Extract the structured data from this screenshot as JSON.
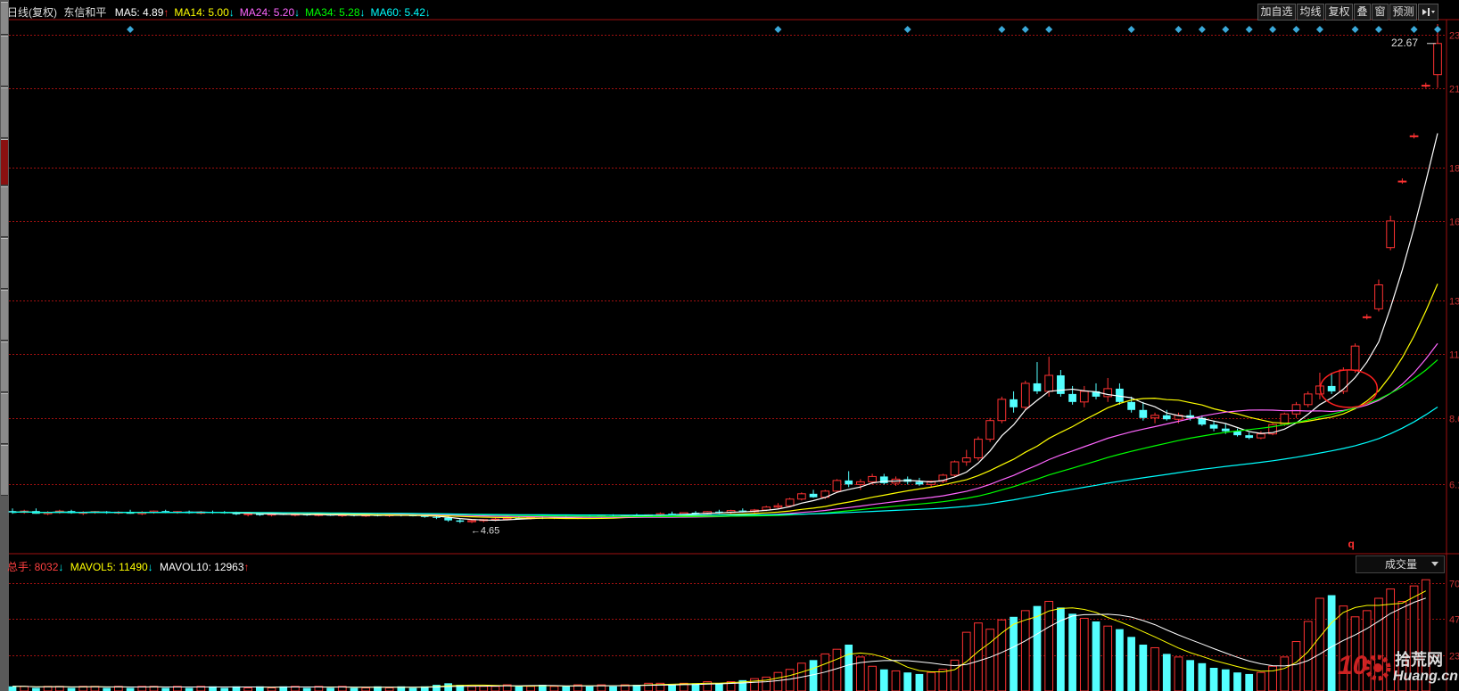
{
  "header": {
    "period": "日线(复权)",
    "stock_name": "东信和平",
    "ma": [
      {
        "label": "MA5: 4.89",
        "arrow": "↑",
        "color": "#ffffff",
        "arrow_color": "#ff3030"
      },
      {
        "label": "MA14: 5.00",
        "arrow": "↓",
        "color": "#ffff00",
        "arrow_color": "#00ffff"
      },
      {
        "label": "MA24: 5.20",
        "arrow": "↓",
        "color": "#ff66ff",
        "arrow_color": "#00ffff"
      },
      {
        "label": "MA34: 5.28",
        "arrow": "↓",
        "color": "#00ff00",
        "arrow_color": "#00ffff"
      },
      {
        "label": "MA60: 5.42",
        "arrow": "↓",
        "color": "#00ffff",
        "arrow_color": "#00ffff"
      }
    ]
  },
  "toolbar": {
    "add_watch": "加自选",
    "avg_line": "均线",
    "rights": "复权",
    "overlay": "叠",
    "window": "窗",
    "forecast": "预测",
    "menu_icon": "dropdown-arrow-icon"
  },
  "volume_panel": {
    "total_label": "总手: 8032",
    "total_arrow": "↓",
    "mavol5": "MAVOL5: 11490",
    "mavol5_arrow": "↓",
    "mavol10": "MAVOL10: 12963",
    "mavol10_arrow": "↑",
    "indicator": "成交量",
    "y_ticks": [
      "70",
      "47",
      "23"
    ]
  },
  "annotations": {
    "high_label": "22.67",
    "low_label": "4.65",
    "q_label": "q"
  },
  "watermark": {
    "line1": "10",
    "line2": "拾荒网",
    "line3": "Huang.cn"
  },
  "colors": {
    "up": "#ff3232",
    "down": "#54ffff",
    "ma5": "#ffffff",
    "ma14": "#ffff00",
    "ma24": "#ff66ff",
    "ma34": "#00ff00",
    "ma60": "#00ffff",
    "grid": "#a01010"
  },
  "chart_data": {
    "type": "candlestick",
    "title": "东信和平 日线(复权)",
    "price_axis_ticks": [
      "23",
      "21",
      "18",
      "16",
      "13",
      "11",
      "8.6",
      "6.1"
    ],
    "ylim": [
      3.7,
      23.5
    ],
    "grid": true,
    "candles_ohlc": [
      [
        5.1,
        5.2,
        5.0,
        5.05
      ],
      [
        5.05,
        5.15,
        5.0,
        5.1
      ],
      [
        5.1,
        5.2,
        5.0,
        5.0
      ],
      [
        5.0,
        5.1,
        4.95,
        5.05
      ],
      [
        5.05,
        5.15,
        5.0,
        5.1
      ],
      [
        5.1,
        5.15,
        5.0,
        5.02
      ],
      [
        5.02,
        5.1,
        4.95,
        5.05
      ],
      [
        5.05,
        5.1,
        5.0,
        5.08
      ],
      [
        5.08,
        5.1,
        5.0,
        5.03
      ],
      [
        5.03,
        5.1,
        4.98,
        5.06
      ],
      [
        5.06,
        5.15,
        5.0,
        5.0
      ],
      [
        5.0,
        5.1,
        4.95,
        5.05
      ],
      [
        5.05,
        5.12,
        5.0,
        5.1
      ],
      [
        5.1,
        5.15,
        5.02,
        5.04
      ],
      [
        5.04,
        5.1,
        5.0,
        5.08
      ],
      [
        5.08,
        5.12,
        5.0,
        5.02
      ],
      [
        5.02,
        5.1,
        4.98,
        5.06
      ],
      [
        5.06,
        5.12,
        5.0,
        5.05
      ],
      [
        5.05,
        5.1,
        5.0,
        5.02
      ],
      [
        5.02,
        5.08,
        4.95,
        4.98
      ],
      [
        4.98,
        5.05,
        4.9,
        5.0
      ],
      [
        5.0,
        5.05,
        4.92,
        4.95
      ],
      [
        4.95,
        5.02,
        4.9,
        5.0
      ],
      [
        5.0,
        5.05,
        4.95,
        4.96
      ],
      [
        4.96,
        5.0,
        4.9,
        4.98
      ],
      [
        4.98,
        5.02,
        4.92,
        4.94
      ],
      [
        4.94,
        5.0,
        4.9,
        4.97
      ],
      [
        4.97,
        5.0,
        4.92,
        4.93
      ],
      [
        4.93,
        5.0,
        4.88,
        4.96
      ],
      [
        4.96,
        5.0,
        4.9,
        4.92
      ],
      [
        4.92,
        4.98,
        4.88,
        4.95
      ],
      [
        4.95,
        5.0,
        4.9,
        4.93
      ],
      [
        4.93,
        4.98,
        4.88,
        4.96
      ],
      [
        4.96,
        5.0,
        4.9,
        4.94
      ],
      [
        4.94,
        4.98,
        4.9,
        4.92
      ],
      [
        4.92,
        4.95,
        4.85,
        4.88
      ],
      [
        4.88,
        4.92,
        4.8,
        4.85
      ],
      [
        4.85,
        4.9,
        4.7,
        4.75
      ],
      [
        4.75,
        4.8,
        4.65,
        4.7
      ],
      [
        4.7,
        4.78,
        4.65,
        4.74
      ],
      [
        4.74,
        4.8,
        4.68,
        4.78
      ],
      [
        4.78,
        4.85,
        4.72,
        4.8
      ],
      [
        4.8,
        4.88,
        4.75,
        4.84
      ],
      [
        4.84,
        4.9,
        4.78,
        4.82
      ],
      [
        4.82,
        4.9,
        4.78,
        4.86
      ],
      [
        4.86,
        4.92,
        4.8,
        4.84
      ],
      [
        4.84,
        4.9,
        4.8,
        4.88
      ],
      [
        4.88,
        4.95,
        4.82,
        4.86
      ],
      [
        4.86,
        4.92,
        4.8,
        4.9
      ],
      [
        4.9,
        4.96,
        4.85,
        4.88
      ],
      [
        4.88,
        4.95,
        4.82,
        4.92
      ],
      [
        4.92,
        4.98,
        4.86,
        4.9
      ],
      [
        4.9,
        4.96,
        4.85,
        4.94
      ],
      [
        4.94,
        5.0,
        4.88,
        4.92
      ],
      [
        4.92,
        4.98,
        4.88,
        4.96
      ],
      [
        4.96,
        5.05,
        4.9,
        5.0
      ],
      [
        5.0,
        5.08,
        4.95,
        4.98
      ],
      [
        4.98,
        5.05,
        4.92,
        5.04
      ],
      [
        5.04,
        5.1,
        4.98,
        5.0
      ],
      [
        5.0,
        5.1,
        4.95,
        5.08
      ],
      [
        5.08,
        5.15,
        5.0,
        5.05
      ],
      [
        5.05,
        5.15,
        5.0,
        5.12
      ],
      [
        5.12,
        5.2,
        5.05,
        5.08
      ],
      [
        5.08,
        5.18,
        5.02,
        5.14
      ],
      [
        5.14,
        5.3,
        5.1,
        5.25
      ],
      [
        5.25,
        5.4,
        5.2,
        5.3
      ],
      [
        5.3,
        5.6,
        5.25,
        5.55
      ],
      [
        5.55,
        5.8,
        5.5,
        5.75
      ],
      [
        5.75,
        5.9,
        5.6,
        5.62
      ],
      [
        5.62,
        5.9,
        5.55,
        5.85
      ],
      [
        5.85,
        6.3,
        5.8,
        6.25
      ],
      [
        6.25,
        6.6,
        6.0,
        6.1
      ],
      [
        6.1,
        6.3,
        5.9,
        6.2
      ],
      [
        6.2,
        6.5,
        6.1,
        6.4
      ],
      [
        6.4,
        6.5,
        6.1,
        6.15
      ],
      [
        6.15,
        6.4,
        6.05,
        6.3
      ],
      [
        6.3,
        6.4,
        6.1,
        6.2
      ],
      [
        6.2,
        6.35,
        6.05,
        6.1
      ],
      [
        6.1,
        6.25,
        6.0,
        6.22
      ],
      [
        6.22,
        6.5,
        6.15,
        6.45
      ],
      [
        6.45,
        7.0,
        6.4,
        6.95
      ],
      [
        6.95,
        7.4,
        6.8,
        7.1
      ],
      [
        7.1,
        7.9,
        7.0,
        7.8
      ],
      [
        7.8,
        8.6,
        7.7,
        8.5
      ],
      [
        8.5,
        9.4,
        8.4,
        9.3
      ],
      [
        9.3,
        9.6,
        8.8,
        9.0
      ],
      [
        9.0,
        10.0,
        8.9,
        9.9
      ],
      [
        9.9,
        10.7,
        9.5,
        9.6
      ],
      [
        9.6,
        10.9,
        9.4,
        10.2
      ],
      [
        10.2,
        10.4,
        9.4,
        9.5
      ],
      [
        9.5,
        9.8,
        9.1,
        9.2
      ],
      [
        9.2,
        9.8,
        9.0,
        9.6
      ],
      [
        9.6,
        9.9,
        9.3,
        9.4
      ],
      [
        9.4,
        10.1,
        9.2,
        9.7
      ],
      [
        9.7,
        9.9,
        9.1,
        9.2
      ],
      [
        9.2,
        9.4,
        8.8,
        8.9
      ],
      [
        8.9,
        9.2,
        8.5,
        8.6
      ],
      [
        8.6,
        8.8,
        8.4,
        8.7
      ],
      [
        8.7,
        8.9,
        8.5,
        8.55
      ],
      [
        8.55,
        8.8,
        8.4,
        8.7
      ],
      [
        8.7,
        8.9,
        8.5,
        8.6
      ],
      [
        8.6,
        8.7,
        8.3,
        8.35
      ],
      [
        8.35,
        8.5,
        8.1,
        8.2
      ],
      [
        8.2,
        8.4,
        8.0,
        8.1
      ],
      [
        8.1,
        8.2,
        7.9,
        7.95
      ],
      [
        7.95,
        8.05,
        7.8,
        7.85
      ],
      [
        7.85,
        8.1,
        7.8,
        8.0
      ],
      [
        8.0,
        8.4,
        7.95,
        8.35
      ],
      [
        8.35,
        8.8,
        8.3,
        8.75
      ],
      [
        8.75,
        9.2,
        8.6,
        9.1
      ],
      [
        9.1,
        9.6,
        9.0,
        9.5
      ],
      [
        9.5,
        10.3,
        9.3,
        9.8
      ],
      [
        9.8,
        10.3,
        9.5,
        9.6
      ],
      [
        9.6,
        10.5,
        9.5,
        10.4
      ],
      [
        10.4,
        11.4,
        10.3,
        11.3
      ],
      [
        12.4,
        12.5,
        12.3,
        12.4
      ],
      [
        12.7,
        13.8,
        12.6,
        13.6
      ],
      [
        15.0,
        16.2,
        14.9,
        16.0
      ],
      [
        17.5,
        17.6,
        17.4,
        17.5
      ],
      [
        19.2,
        19.3,
        19.1,
        19.2
      ],
      [
        21.1,
        21.2,
        21.0,
        21.1
      ],
      [
        21.5,
        23.4,
        21.0,
        22.67
      ]
    ],
    "volume": [
      3,
      3,
      2,
      3,
      3,
      2,
      3,
      3,
      2,
      3,
      2,
      3,
      3,
      2,
      3,
      2,
      3,
      3,
      2,
      3,
      2,
      3,
      2,
      3,
      3,
      2,
      3,
      2,
      3,
      2,
      2,
      3,
      2,
      3,
      2,
      3,
      4,
      5,
      4,
      3,
      3,
      3,
      4,
      3,
      3,
      4,
      3,
      3,
      4,
      3,
      4,
      3,
      4,
      4,
      5,
      5,
      4,
      5,
      5,
      6,
      5,
      6,
      7,
      8,
      9,
      12,
      14,
      18,
      20,
      24,
      27,
      30,
      22,
      16,
      14,
      13,
      12,
      11,
      12,
      14,
      20,
      38,
      44,
      40,
      46,
      48,
      52,
      55,
      58,
      54,
      50,
      47,
      45,
      42,
      40,
      35,
      30,
      28,
      24,
      22,
      20,
      18,
      15,
      14,
      12,
      11,
      12,
      16,
      22,
      32,
      45,
      60,
      62,
      55,
      48,
      52,
      60,
      66,
      58,
      68,
      72
    ],
    "mavol5_series": [
      3,
      3,
      3,
      3,
      3,
      3,
      3,
      3,
      3,
      3,
      4,
      4,
      4,
      5,
      6,
      8,
      10,
      14,
      18,
      21,
      23,
      21,
      18,
      16,
      15,
      14,
      18,
      27,
      35,
      44,
      49,
      52,
      50,
      48,
      45,
      40,
      33,
      27,
      22,
      19,
      17,
      15,
      14,
      18,
      26,
      42,
      55,
      60,
      62,
      57,
      40
    ],
    "mavol10_series": [
      3,
      3,
      3,
      3,
      3,
      3,
      3,
      3,
      3,
      3,
      3,
      4,
      4,
      5,
      6,
      8,
      11,
      14,
      16,
      17,
      18,
      18,
      19,
      22,
      26,
      31,
      35,
      39,
      42,
      44,
      45,
      42,
      38,
      35,
      33,
      30,
      27,
      24,
      22,
      21,
      22,
      30,
      40,
      48,
      52,
      50,
      45,
      42
    ]
  }
}
